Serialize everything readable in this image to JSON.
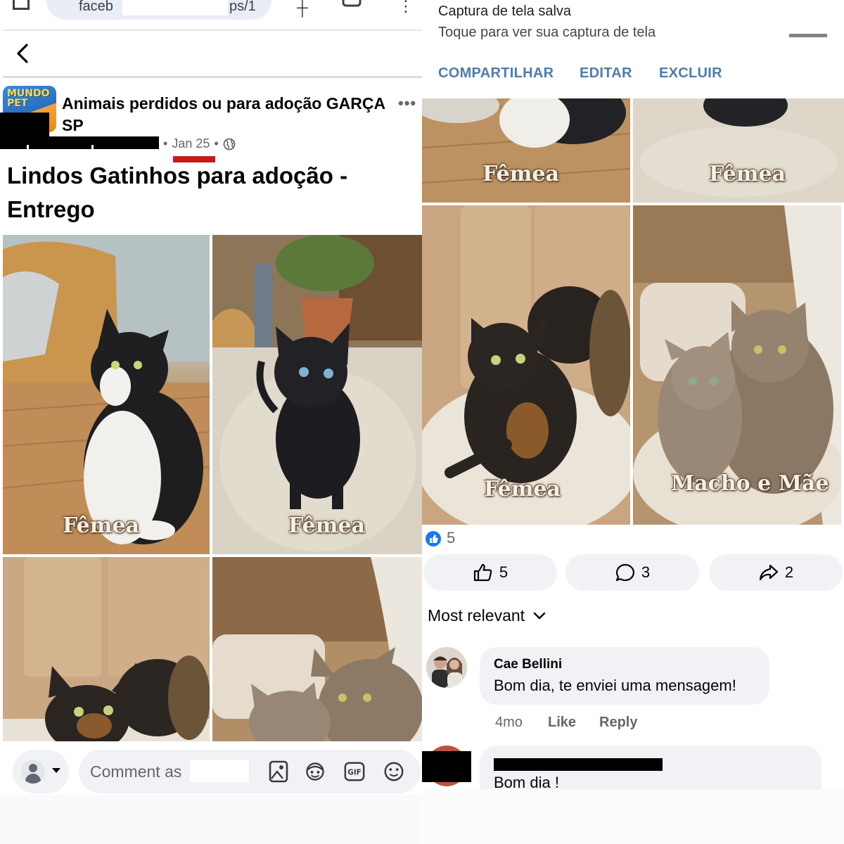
{
  "browser": {
    "url_start": "faceb",
    "url_end": "ps/1"
  },
  "post": {
    "group_name": "Animais perdidos ou para adoção GARÇA SP",
    "group_logo_text": "MUNDO PET",
    "date": "Jan 25",
    "separator": "•",
    "title": "Lindos Gatinhos para adoção - Entrego",
    "photos": [
      {
        "label": "Fêmea",
        "icon": "kitten-black-white-photo"
      },
      {
        "label": "Fêmea",
        "icon": "kitten-black-blue-eyes-photo"
      },
      {
        "label": "",
        "icon": "tortoiseshell-kitten-photo"
      },
      {
        "label": "",
        "icon": "tabby-cats-photo"
      }
    ]
  },
  "comment_box": {
    "placeholder": "Comment as",
    "icons": [
      "photo-icon",
      "avatar-sticker-icon",
      "gif-icon",
      "emoji-icon"
    ]
  },
  "notification": {
    "title": "Captura de tela salva",
    "subtitle": "Toque para ver sua captura de tela",
    "actions": [
      "COMPARTILHAR",
      "EDITAR",
      "EXCLUIR"
    ]
  },
  "right_photos": [
    {
      "label": "Fêmea"
    },
    {
      "label": "Fêmea"
    },
    {
      "label": "Fêmea"
    },
    {
      "label": "Macho e Mãe"
    }
  ],
  "reactions": {
    "likes": "5",
    "like_button_count": "5",
    "comment_count": "3",
    "share_count": "2"
  },
  "comments": {
    "sort_label": "Most relevant",
    "items": [
      {
        "author": "Cae Bellini",
        "text": "Bom dia, te enviei uma mensagem!",
        "age": "4mo",
        "like": "Like",
        "reply": "Reply"
      },
      {
        "author": "",
        "text": "Bom dia !"
      }
    ]
  },
  "colors": {
    "fb_blue": "#1877f2",
    "notif_action": "#4e7cae",
    "date_underline": "#c8191b",
    "pill_bg": "#f0f2f5"
  }
}
